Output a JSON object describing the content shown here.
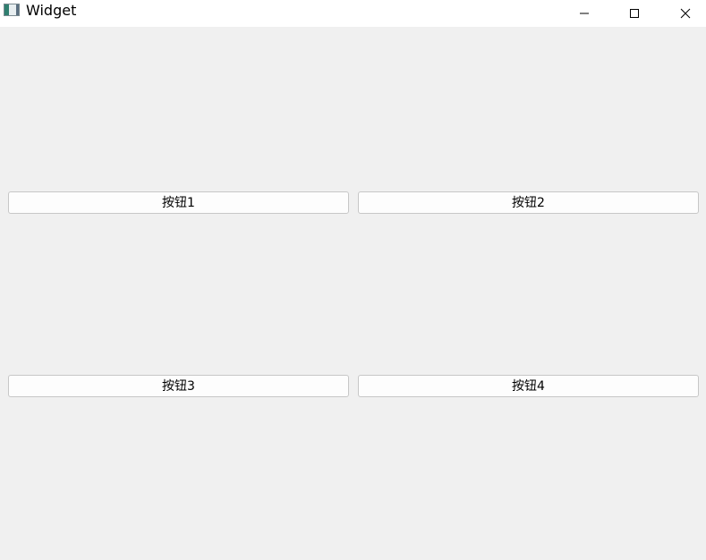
{
  "window": {
    "title": "Widget",
    "icon": "app-window-icon",
    "controls": {
      "minimize_icon": "minimize-icon",
      "maximize_icon": "maximize-icon",
      "close_icon": "close-icon"
    }
  },
  "buttons": [
    {
      "label": "按钮1"
    },
    {
      "label": "按钮2"
    },
    {
      "label": "按钮3"
    },
    {
      "label": "按钮4"
    }
  ]
}
